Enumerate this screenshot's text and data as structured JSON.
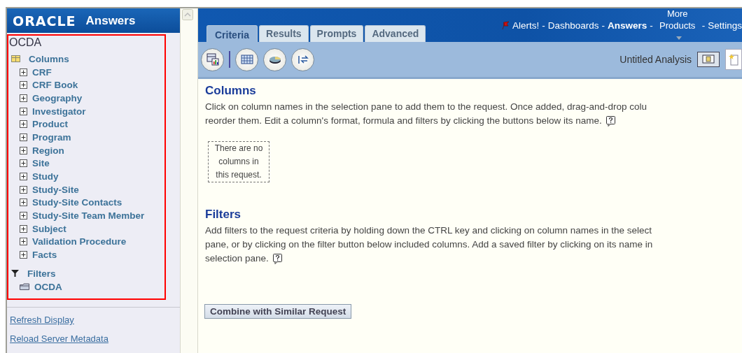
{
  "sidebar": {
    "logo": "ORACLE",
    "product": "Answers",
    "subject_area": "OCDA",
    "columns_folder": {
      "label": "Columns",
      "children": [
        {
          "label": "CRF",
          "expanded": false
        },
        {
          "label": "CRF Book",
          "expanded": false
        },
        {
          "label": "Geography",
          "expanded": false
        },
        {
          "label": "Investigator",
          "expanded": false
        },
        {
          "label": "Product",
          "expanded": false
        },
        {
          "label": "Program",
          "expanded": false
        },
        {
          "label": "Region",
          "expanded": false
        },
        {
          "label": "Site",
          "expanded": false
        },
        {
          "label": "Study",
          "expanded": false
        },
        {
          "label": "Study-Site",
          "expanded": false
        },
        {
          "label": "Study-Site Contacts",
          "expanded": false
        },
        {
          "label": "Study-Site Team Member",
          "expanded": false
        },
        {
          "label": "Subject",
          "expanded": false
        },
        {
          "label": "Validation Procedure",
          "expanded": false
        },
        {
          "label": "Facts",
          "expanded": false
        }
      ]
    },
    "filters_folder": {
      "label": "Filters",
      "children": [
        {
          "label": "OCDA"
        }
      ]
    },
    "links": [
      "Refresh Display",
      "Reload Server Metadata"
    ]
  },
  "header": {
    "tabs": [
      {
        "label": "Criteria",
        "selected": true
      },
      {
        "label": "Results",
        "selected": false
      },
      {
        "label": "Prompts",
        "selected": false
      },
      {
        "label": "Advanced",
        "selected": false
      }
    ],
    "nav_separator": "-",
    "nav": [
      {
        "label": "Alerts!",
        "current": false,
        "kind": "alert"
      },
      {
        "label": "Dashboards",
        "current": false,
        "kind": "link"
      },
      {
        "label": "Answers",
        "current": true,
        "kind": "link"
      },
      {
        "label": "More Products",
        "current": false,
        "kind": "menu"
      },
      {
        "label": "Settings",
        "current": false,
        "kind": "link"
      }
    ]
  },
  "toolbar": {
    "analysis_title": "Untitled Analysis"
  },
  "sections": [
    {
      "title": "Columns",
      "lines": [
        "Click on column names in the selection pane to add them to the request. Once added, drag-and-drop colu",
        "reorder them. Edit a column's format, formula and filters by clicking the buttons below its name."
      ],
      "empty_note": "There are no columns in this request."
    },
    {
      "title": "Filters",
      "lines": [
        "Add filters to the request criteria by holding down the CTRL key and clicking on column names in the select",
        "pane, or by clicking on the filter button below included columns. Add a saved filter by clicking on its name in",
        "selection pane."
      ]
    }
  ],
  "combine_button": "Combine with Similar Request"
}
